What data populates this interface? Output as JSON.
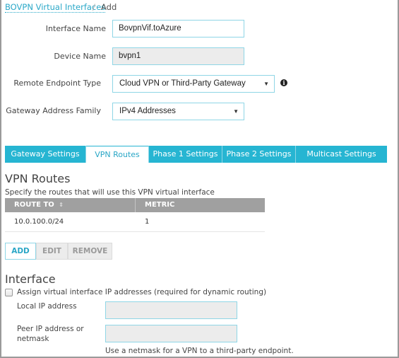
{
  "breadcrumb": {
    "parent": "BOVPN Virtual Interfaces",
    "separator": "/",
    "current": "Add"
  },
  "form": {
    "interface_name": {
      "label": "Interface Name",
      "value": "BovpnVif.toAzure"
    },
    "device_name": {
      "label": "Device Name",
      "value": "bvpn1"
    },
    "remote_endpoint_type": {
      "label": "Remote Endpoint Type",
      "value": "Cloud VPN or Third-Party Gateway",
      "info_icon": "info-icon"
    },
    "gateway_address_family": {
      "label": "Gateway Address Family",
      "value": "IPv4 Addresses"
    }
  },
  "tabs": [
    {
      "label": "Gateway Settings",
      "active": false
    },
    {
      "label": "VPN Routes",
      "active": true
    },
    {
      "label": "Phase 1 Settings",
      "active": false
    },
    {
      "label": "Phase 2 Settings",
      "active": false
    },
    {
      "label": "Multicast Settings",
      "active": false
    }
  ],
  "vpn_routes": {
    "title": "VPN Routes",
    "description": "Specify the routes that will use this VPN virtual interface",
    "columns": [
      "ROUTE TO",
      "METRIC"
    ],
    "sort_icon": "sort-icon",
    "rows": [
      {
        "route_to": "10.0.100.0/24",
        "metric": "1"
      }
    ],
    "buttons": {
      "add": "ADD",
      "edit": "EDIT",
      "remove": "REMOVE"
    }
  },
  "interface": {
    "title": "Interface",
    "checkbox_label": "Assign virtual interface IP addresses (required for dynamic routing)",
    "checked": false,
    "local_ip": {
      "label": "Local IP address",
      "value": ""
    },
    "peer_ip": {
      "label_line1": "Peer IP address or",
      "label_line2": "netmask",
      "value": ""
    },
    "hint": "Use a netmask for a VPN to a third-party endpoint."
  }
}
